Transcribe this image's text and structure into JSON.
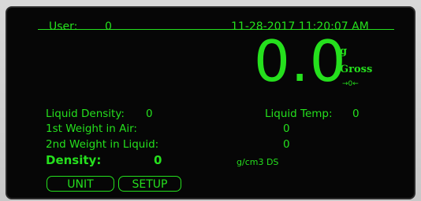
{
  "header": {
    "user_label": "User:",
    "user_value": "0",
    "datetime": "11-28-2017 11:20:07 AM"
  },
  "weight": {
    "value": "0.0",
    "unit": "g",
    "mode": "Gross",
    "zero_indicator": "→0←"
  },
  "readings": {
    "liquid_density_label": "Liquid Density:",
    "liquid_density_value": "0",
    "liquid_temp_label": "Liquid Temp:",
    "liquid_temp_value": "0",
    "weight_air_label": "1st Weight in Air:",
    "weight_air_value": "0",
    "weight_liquid_label": "2nd Weight in Liquid:",
    "weight_liquid_value": "0",
    "density_label": "Density:",
    "density_value": "0",
    "density_unit": "g/cm3 DS"
  },
  "buttons": {
    "unit_label": "UNIT",
    "setup_label": "SETUP"
  },
  "colors": {
    "accent": "#25e01d",
    "background": "#060606"
  }
}
